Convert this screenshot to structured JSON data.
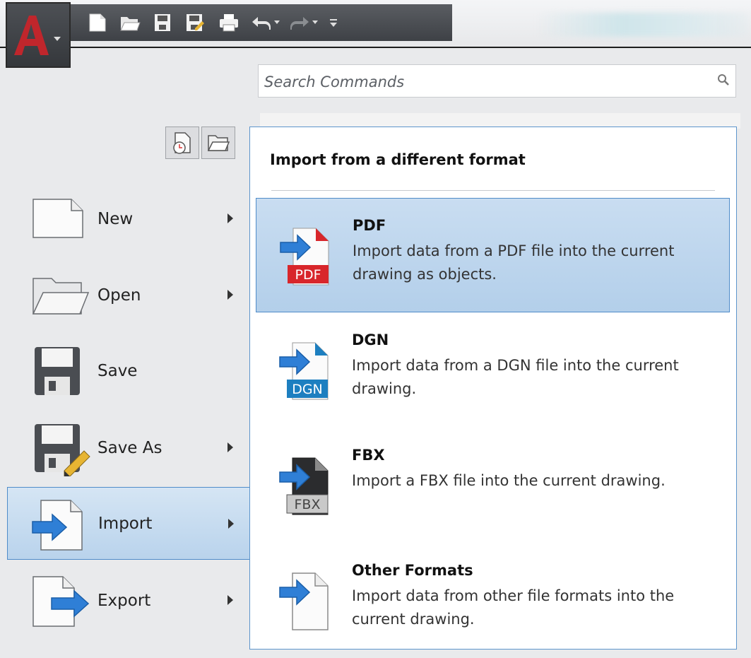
{
  "search": {
    "placeholder": "Search Commands"
  },
  "menu": {
    "items": [
      {
        "label": "New",
        "icon": "new-file-icon",
        "has_submenu": true,
        "active": false
      },
      {
        "label": "Open",
        "icon": "open-folder-icon",
        "has_submenu": true,
        "active": false
      },
      {
        "label": "Save",
        "icon": "save-icon",
        "has_submenu": false,
        "active": false
      },
      {
        "label": "Save As",
        "icon": "save-as-icon",
        "has_submenu": true,
        "active": false
      },
      {
        "label": "Import",
        "icon": "import-icon",
        "has_submenu": true,
        "active": true
      },
      {
        "label": "Export",
        "icon": "export-icon",
        "has_submenu": true,
        "active": false
      }
    ]
  },
  "panel": {
    "title": "Import from a different format",
    "items": [
      {
        "name": "PDF",
        "badge": "PDF",
        "badge_color": "#d8262b",
        "description": "Import data from a PDF file into the current drawing as objects.",
        "active": true
      },
      {
        "name": "DGN",
        "badge": "DGN",
        "badge_color": "#1d7fc0",
        "description": "Import data from a DGN file into the current drawing.",
        "active": false
      },
      {
        "name": "FBX",
        "badge": "FBX",
        "badge_color": "#7a7a7a",
        "description": "Import a FBX file into the current drawing.",
        "active": false
      },
      {
        "name": "Other Formats",
        "badge": "",
        "badge_color": "",
        "description": "Import data from other file formats into the current drawing.",
        "active": false
      }
    ]
  },
  "colors": {
    "accent": "#4f8cc9",
    "selected_bg": "#c9ddf1",
    "arrow_blue": "#2f7fd6",
    "app_red": "#c0262c"
  }
}
